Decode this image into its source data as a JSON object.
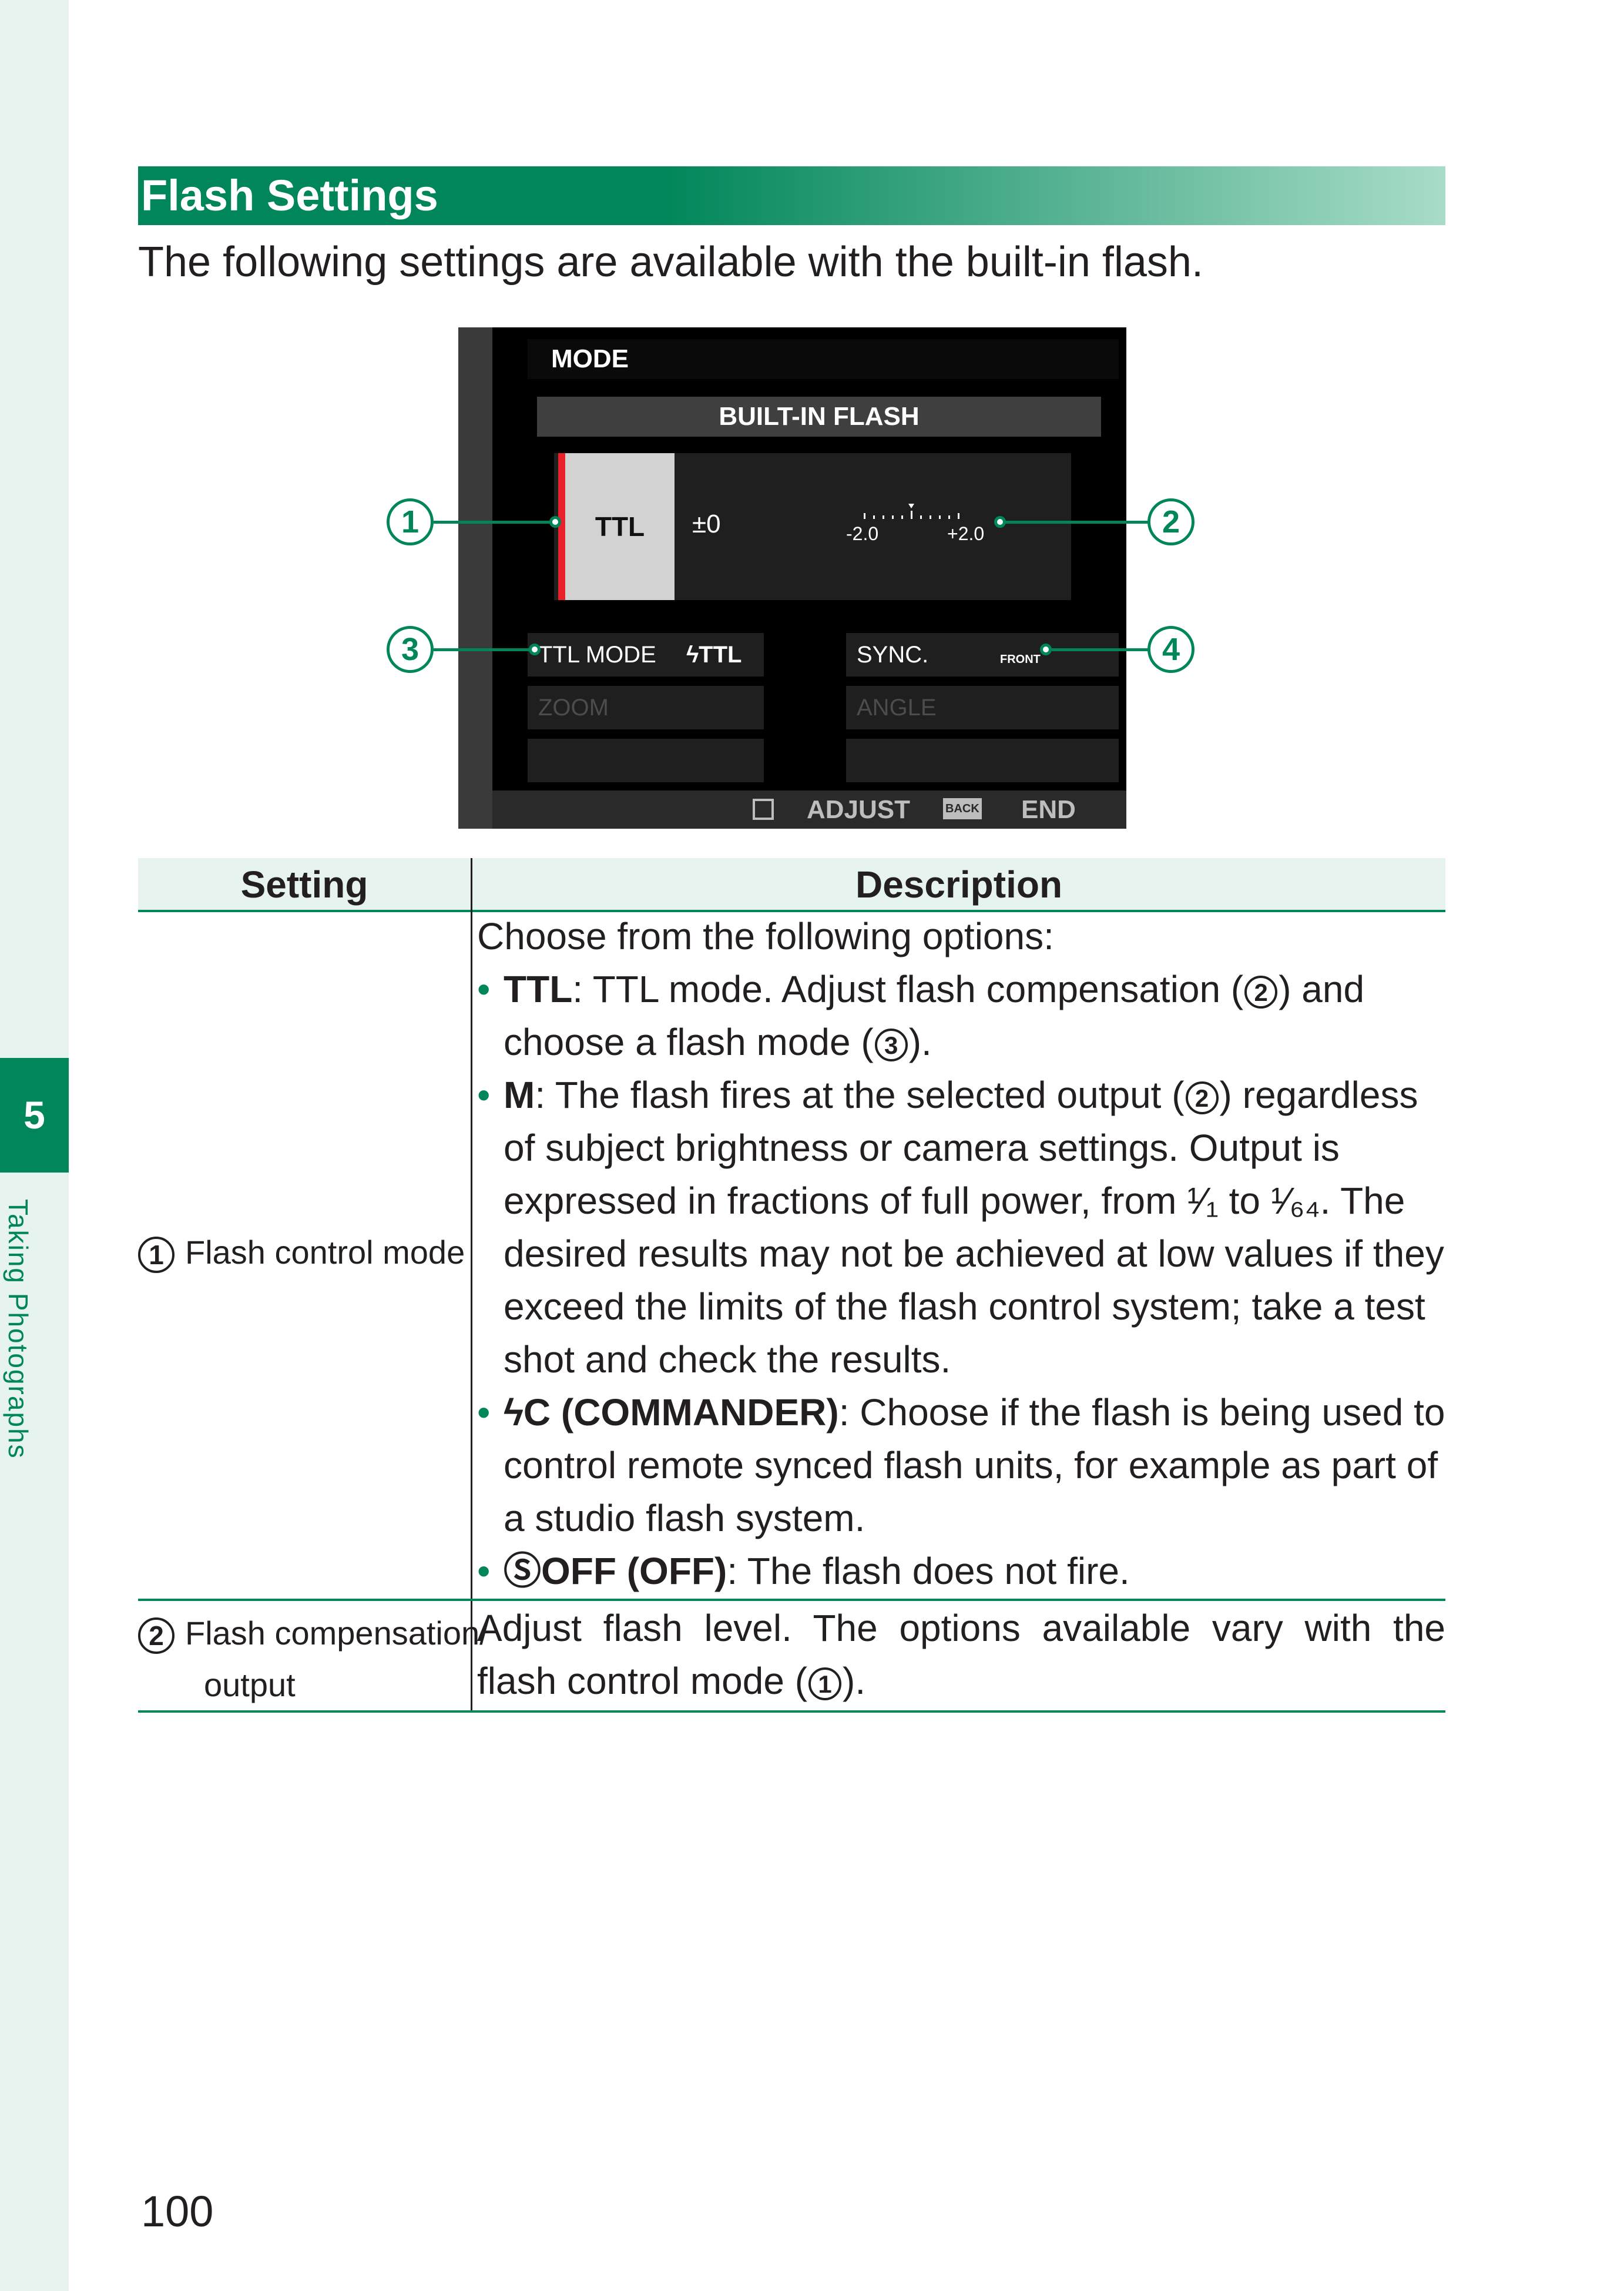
{
  "chapter": {
    "number": "5",
    "title": "Taking Photographs"
  },
  "section": {
    "title": "Flash Settings",
    "intro": "The following settings are available with the built-in flash."
  },
  "screen": {
    "menu_title": "MODE",
    "subtitle": "BUILT-IN FLASH",
    "mode_value": "TTL",
    "compensation": "±0",
    "scale_min": "-2.0",
    "scale_max": "+2.0",
    "ttl_mode_label": "TTL MODE",
    "ttl_mode_value": "ϟTTL",
    "sync_label": "SYNC.",
    "sync_value": "FRONT",
    "zoom_label": "ZOOM",
    "angle_label": "ANGLE",
    "adjust_label": "ADJUST",
    "back_label": "BACK",
    "end_label": "END"
  },
  "callouts": [
    "1",
    "2",
    "3",
    "4"
  ],
  "table": {
    "headers": {
      "setting": "Setting",
      "description": "Description"
    },
    "rows": [
      {
        "num": "1",
        "setting": "Flash control mode",
        "intro": "Choose from the following options:",
        "bullets": [
          {
            "term": "TTL",
            "pre": ": TTL mode.  Adjust flash compensation (",
            "ref1": "2",
            "mid": ") and choose a flash mode (",
            "ref2": "3",
            "post": ")."
          },
          {
            "term": "M",
            "pre": ": The flash fires at the selected output (",
            "ref1": "2",
            "mid": ") regardless of subject brightness or camera settings.  Output is expressed in fractions of full power, from ¹⁄₁ to ¹⁄₆₄.  The desired results may not be achieved at low values if they exceed the limits of the flash control system; take a test shot and check the results.",
            "ref2": "",
            "post": ""
          },
          {
            "term": "ϟC (COMMANDER)",
            "pre": ": Choose if the flash is being used to control remote synced flash units, for example as part of a studio flash system.",
            "ref1": "",
            "mid": "",
            "ref2": "",
            "post": ""
          },
          {
            "term": "ⓈOFF (OFF)",
            "pre": ": The flash does not fire.",
            "ref1": "",
            "mid": "",
            "ref2": "",
            "post": ""
          }
        ]
      },
      {
        "num": "2",
        "setting_line1": "Flash compensation/",
        "setting_line2": "output",
        "desc_pre": "Adjust flash level.  The options available vary with the flash control mode (",
        "desc_ref": "1",
        "desc_post": ")."
      }
    ]
  },
  "page_number": "100",
  "colors": {
    "accent": "#00865a",
    "sidebar": "#e6f3ee",
    "flash_marker": "#e8212b"
  }
}
